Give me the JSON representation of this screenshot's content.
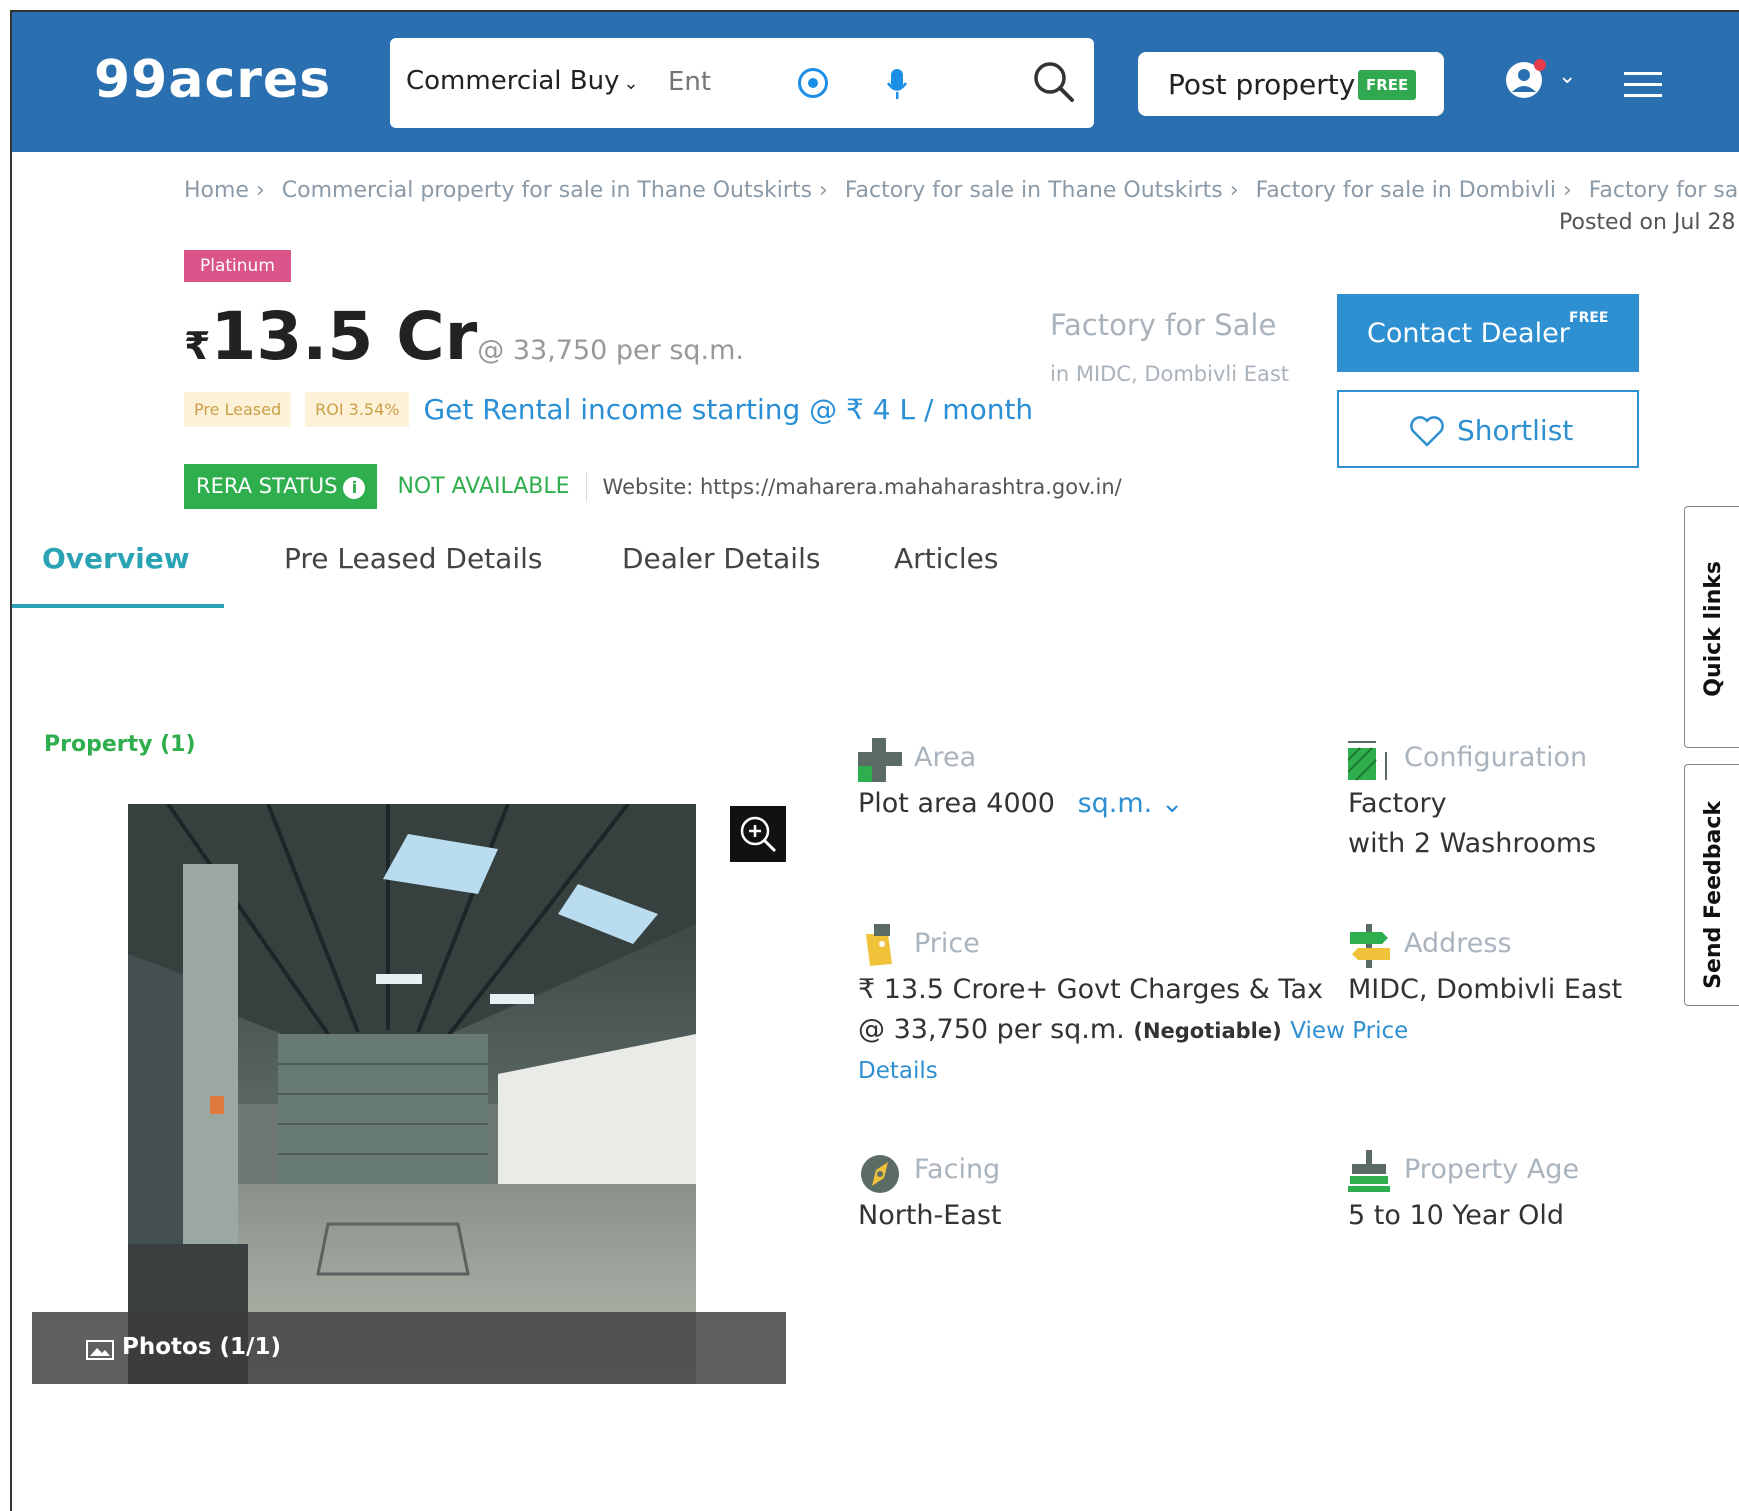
{
  "header": {
    "logo": "99acres",
    "search_category": "Commercial Buy",
    "search_placeholder": "Ent",
    "post_property_label": "Post property",
    "free_badge": "FREE"
  },
  "breadcrumb": [
    "Home ›",
    "Commercial property for sale in Thane Outskirts ›",
    "Factory for sale in Thane Outskirts ›",
    "Factory for sale in Dombivli ›",
    "Factory for sale in MIDC"
  ],
  "posted_on": "Posted on Jul 28",
  "listing": {
    "badge": "Platinum",
    "currency": "₹",
    "price": "13.5 Cr",
    "price_rate": "@ 33,750 per sq.m.",
    "tags": [
      "Pre Leased",
      "ROI 3.54%"
    ],
    "rental_text": "Get Rental income starting @ ₹ 4 L / month",
    "rera_label": "RERA STATUS",
    "rera_value": "NOT AVAILABLE",
    "website": "Website: https://maharera.mahaharashtra.gov.in/",
    "title": "Factory for Sale",
    "location": "in MIDC, Dombivli East",
    "contact_label": "Contact Dealer",
    "contact_free": "FREE",
    "shortlist_label": "Shortlist"
  },
  "tabs": [
    {
      "label": "Overview",
      "active": true
    },
    {
      "label": "Pre Leased Details",
      "active": false
    },
    {
      "label": "Dealer Details",
      "active": false
    },
    {
      "label": "Articles",
      "active": false
    }
  ],
  "side_tabs": {
    "quick_links": "Quick links",
    "send_feedback": "Send Feedback"
  },
  "property": {
    "count_label": "Property (1)",
    "photos_label": "Photos (1/1)"
  },
  "details": {
    "area": {
      "label": "Area",
      "value": "Plot area 4000",
      "unit": "sq.m."
    },
    "configuration": {
      "label": "Configuration",
      "line1": "Factory",
      "line2": "with 2 Washrooms"
    },
    "price": {
      "label": "Price",
      "line1": "₹ 13.5 Crore+ Govt Charges & Tax",
      "line2": "@ 33,750 per sq.m.",
      "negotiable": "(Negotiable)",
      "link": "View Price",
      "link2": "Details"
    },
    "address": {
      "label": "Address",
      "value": "MIDC, Dombivli East"
    },
    "facing": {
      "label": "Facing",
      "value": "North-East"
    },
    "property_age": {
      "label": "Property Age",
      "value": "5 to 10 Year Old"
    }
  },
  "colors": {
    "header_bg": "#2a6fb0",
    "accent_blue": "#2e8fd1",
    "rera_green": "#2fae4d",
    "platinum_pink": "#d9558a",
    "tab_active": "#2aa3b5"
  }
}
